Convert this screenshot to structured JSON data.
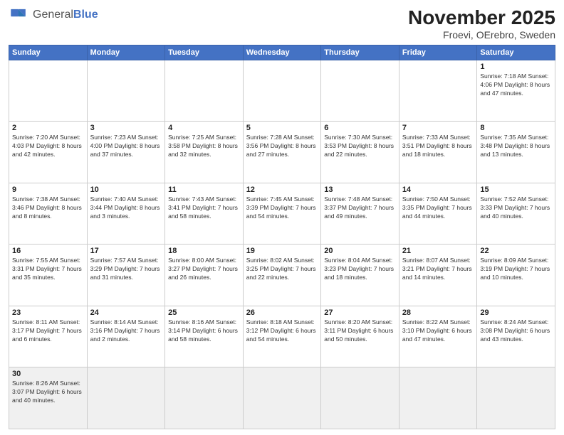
{
  "header": {
    "logo_general": "General",
    "logo_blue": "Blue",
    "title": "November 2025",
    "location": "Froevi, OErebro, Sweden"
  },
  "days_of_week": [
    "Sunday",
    "Monday",
    "Tuesday",
    "Wednesday",
    "Thursday",
    "Friday",
    "Saturday"
  ],
  "weeks": [
    [
      {
        "day": "",
        "info": ""
      },
      {
        "day": "",
        "info": ""
      },
      {
        "day": "",
        "info": ""
      },
      {
        "day": "",
        "info": ""
      },
      {
        "day": "",
        "info": ""
      },
      {
        "day": "",
        "info": ""
      },
      {
        "day": "1",
        "info": "Sunrise: 7:18 AM\nSunset: 4:06 PM\nDaylight: 8 hours\nand 47 minutes."
      }
    ],
    [
      {
        "day": "2",
        "info": "Sunrise: 7:20 AM\nSunset: 4:03 PM\nDaylight: 8 hours\nand 42 minutes."
      },
      {
        "day": "3",
        "info": "Sunrise: 7:23 AM\nSunset: 4:00 PM\nDaylight: 8 hours\nand 37 minutes."
      },
      {
        "day": "4",
        "info": "Sunrise: 7:25 AM\nSunset: 3:58 PM\nDaylight: 8 hours\nand 32 minutes."
      },
      {
        "day": "5",
        "info": "Sunrise: 7:28 AM\nSunset: 3:56 PM\nDaylight: 8 hours\nand 27 minutes."
      },
      {
        "day": "6",
        "info": "Sunrise: 7:30 AM\nSunset: 3:53 PM\nDaylight: 8 hours\nand 22 minutes."
      },
      {
        "day": "7",
        "info": "Sunrise: 7:33 AM\nSunset: 3:51 PM\nDaylight: 8 hours\nand 18 minutes."
      },
      {
        "day": "8",
        "info": "Sunrise: 7:35 AM\nSunset: 3:48 PM\nDaylight: 8 hours\nand 13 minutes."
      }
    ],
    [
      {
        "day": "9",
        "info": "Sunrise: 7:38 AM\nSunset: 3:46 PM\nDaylight: 8 hours\nand 8 minutes."
      },
      {
        "day": "10",
        "info": "Sunrise: 7:40 AM\nSunset: 3:44 PM\nDaylight: 8 hours\nand 3 minutes."
      },
      {
        "day": "11",
        "info": "Sunrise: 7:43 AM\nSunset: 3:41 PM\nDaylight: 7 hours\nand 58 minutes."
      },
      {
        "day": "12",
        "info": "Sunrise: 7:45 AM\nSunset: 3:39 PM\nDaylight: 7 hours\nand 54 minutes."
      },
      {
        "day": "13",
        "info": "Sunrise: 7:48 AM\nSunset: 3:37 PM\nDaylight: 7 hours\nand 49 minutes."
      },
      {
        "day": "14",
        "info": "Sunrise: 7:50 AM\nSunset: 3:35 PM\nDaylight: 7 hours\nand 44 minutes."
      },
      {
        "day": "15",
        "info": "Sunrise: 7:52 AM\nSunset: 3:33 PM\nDaylight: 7 hours\nand 40 minutes."
      }
    ],
    [
      {
        "day": "16",
        "info": "Sunrise: 7:55 AM\nSunset: 3:31 PM\nDaylight: 7 hours\nand 35 minutes."
      },
      {
        "day": "17",
        "info": "Sunrise: 7:57 AM\nSunset: 3:29 PM\nDaylight: 7 hours\nand 31 minutes."
      },
      {
        "day": "18",
        "info": "Sunrise: 8:00 AM\nSunset: 3:27 PM\nDaylight: 7 hours\nand 26 minutes."
      },
      {
        "day": "19",
        "info": "Sunrise: 8:02 AM\nSunset: 3:25 PM\nDaylight: 7 hours\nand 22 minutes."
      },
      {
        "day": "20",
        "info": "Sunrise: 8:04 AM\nSunset: 3:23 PM\nDaylight: 7 hours\nand 18 minutes."
      },
      {
        "day": "21",
        "info": "Sunrise: 8:07 AM\nSunset: 3:21 PM\nDaylight: 7 hours\nand 14 minutes."
      },
      {
        "day": "22",
        "info": "Sunrise: 8:09 AM\nSunset: 3:19 PM\nDaylight: 7 hours\nand 10 minutes."
      }
    ],
    [
      {
        "day": "23",
        "info": "Sunrise: 8:11 AM\nSunset: 3:17 PM\nDaylight: 7 hours\nand 6 minutes."
      },
      {
        "day": "24",
        "info": "Sunrise: 8:14 AM\nSunset: 3:16 PM\nDaylight: 7 hours\nand 2 minutes."
      },
      {
        "day": "25",
        "info": "Sunrise: 8:16 AM\nSunset: 3:14 PM\nDaylight: 6 hours\nand 58 minutes."
      },
      {
        "day": "26",
        "info": "Sunrise: 8:18 AM\nSunset: 3:12 PM\nDaylight: 6 hours\nand 54 minutes."
      },
      {
        "day": "27",
        "info": "Sunrise: 8:20 AM\nSunset: 3:11 PM\nDaylight: 6 hours\nand 50 minutes."
      },
      {
        "day": "28",
        "info": "Sunrise: 8:22 AM\nSunset: 3:10 PM\nDaylight: 6 hours\nand 47 minutes."
      },
      {
        "day": "29",
        "info": "Sunrise: 8:24 AM\nSunset: 3:08 PM\nDaylight: 6 hours\nand 43 minutes."
      }
    ],
    [
      {
        "day": "30",
        "info": "Sunrise: 8:26 AM\nSunset: 3:07 PM\nDaylight: 6 hours\nand 40 minutes."
      },
      {
        "day": "",
        "info": ""
      },
      {
        "day": "",
        "info": ""
      },
      {
        "day": "",
        "info": ""
      },
      {
        "day": "",
        "info": ""
      },
      {
        "day": "",
        "info": ""
      },
      {
        "day": "",
        "info": ""
      }
    ]
  ]
}
